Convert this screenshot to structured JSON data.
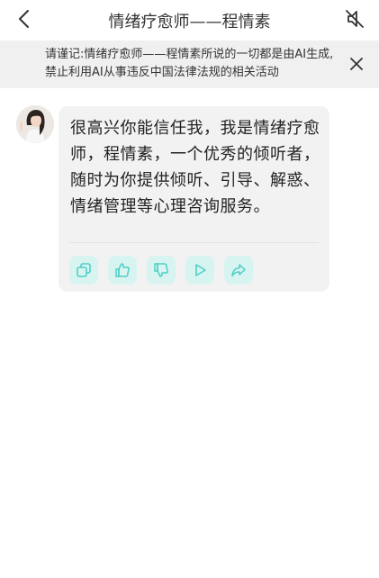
{
  "header": {
    "title": "情绪疗愈师——程情素",
    "back_icon": "chevron-left-icon",
    "mute_icon": "speaker-muted-icon"
  },
  "notice": {
    "text": "请谨记:情绪疗愈师——程情素所说的一切都是由AI生成,禁止利用AI从事违反中国法律法规的相关活动",
    "close_icon": "close-icon"
  },
  "message": {
    "avatar_icon": "assistant-avatar",
    "text": "很高兴你能信任我，我是情绪疗愈师，程情素，一个优秀的倾听者，随时为你提供倾听、引导、解惑、情绪管理等心理咨询服务。",
    "actions": [
      "copy-icon",
      "thumbs-up-icon",
      "thumbs-down-icon",
      "play-icon",
      "share-icon"
    ]
  },
  "colors": {
    "accent": "#4ccfc6",
    "action_bg": "#d8f4f1",
    "bubble_bg": "#f2f2f2",
    "banner_bg": "#f0f0f0"
  }
}
